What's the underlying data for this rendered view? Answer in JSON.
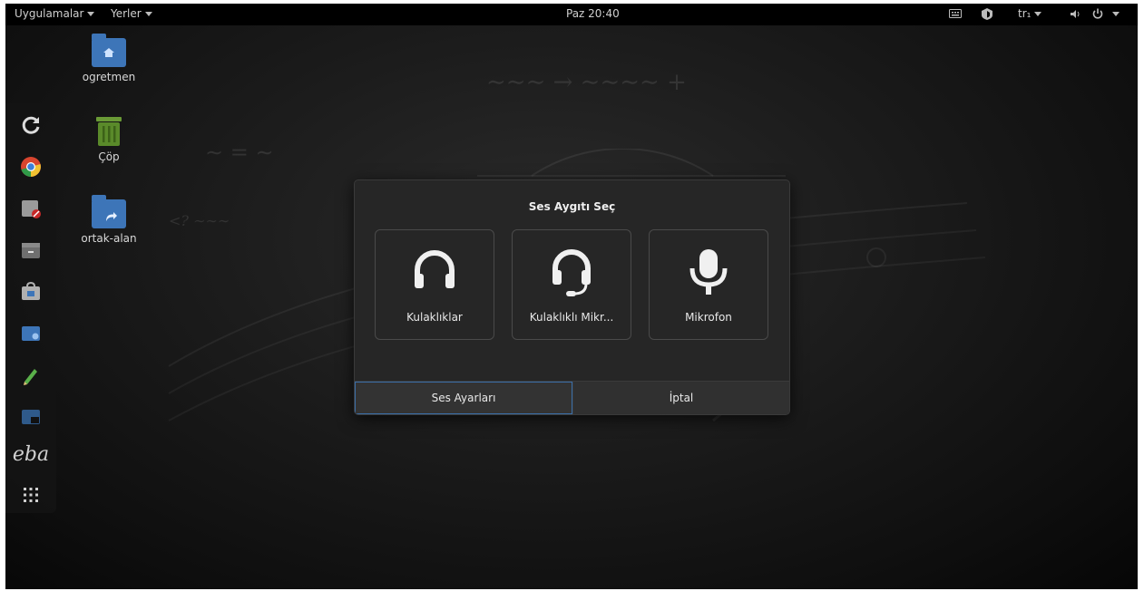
{
  "topbar": {
    "applications": "Uygulamalar",
    "places": "Yerler",
    "clock": "Paz 20:40",
    "keyboard_layout": "tr₁",
    "icons": [
      "keyboard-icon",
      "network-icon",
      "volume-icon",
      "power-icon"
    ]
  },
  "desktop": {
    "icons": [
      {
        "label": "ogretmen",
        "icon": "home-folder-icon"
      },
      {
        "label": "Çöp",
        "icon": "trash-icon"
      },
      {
        "label": "ortak-alan",
        "icon": "shared-folder-icon"
      }
    ]
  },
  "dock": {
    "items": [
      "reload-icon",
      "chrome-icon",
      "settings-icon",
      "files-icon",
      "software-center-icon",
      "screenshot-icon",
      "pencil-icon",
      "terminal-icon",
      "eba-logo",
      "app-grid-icon"
    ],
    "eba_text": "eba"
  },
  "dialog": {
    "title": "Ses Aygıtı Seç",
    "devices": [
      {
        "label": "Kulaklıklar",
        "icon": "headphones-icon"
      },
      {
        "label": "Kulaklıklı Mikr...",
        "icon": "headset-icon"
      },
      {
        "label": "Mikrofon",
        "icon": "microphone-icon"
      }
    ],
    "buttons": {
      "sound_settings": "Ses Ayarları",
      "cancel": "İptal"
    }
  },
  "colors": {
    "panel": "#000000",
    "dialog_bg": "#262626",
    "focus_border": "#3a6ea8",
    "folder": "#3d75b8",
    "trash": "#5a8a2a"
  }
}
